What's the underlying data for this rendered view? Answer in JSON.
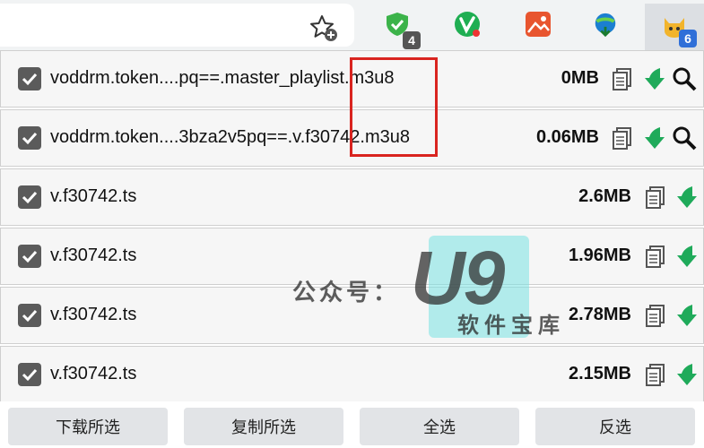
{
  "toolbar": {
    "extensions": [
      {
        "name": "shield-extension",
        "badge": "4",
        "color": "#3cb34a"
      },
      {
        "name": "v-extension",
        "badge": "",
        "color": "#1fae52"
      },
      {
        "name": "image-extension",
        "badge": "",
        "color": "#e8552f"
      },
      {
        "name": "idm-extension",
        "badge": "",
        "color": "#1b7fd1"
      },
      {
        "name": "cat-extension",
        "badge": "6",
        "color": "#f2b42c"
      }
    ]
  },
  "rows": [
    {
      "filename": "voddrm.token....pq==.master_playlist.m3u8",
      "size": "0MB",
      "checked": true,
      "has_search": true
    },
    {
      "filename": "voddrm.token....3bza2v5pq==.v.f30742.m3u8",
      "size": "0.06MB",
      "checked": true,
      "has_search": true
    },
    {
      "filename": "v.f30742.ts",
      "size": "2.6MB",
      "checked": true,
      "has_search": false
    },
    {
      "filename": "v.f30742.ts",
      "size": "1.96MB",
      "checked": true,
      "has_search": false
    },
    {
      "filename": "v.f30742.ts",
      "size": "2.78MB",
      "checked": true,
      "has_search": false
    },
    {
      "filename": "v.f30742.ts",
      "size": "2.15MB",
      "checked": true,
      "has_search": false
    }
  ],
  "watermark": {
    "prefix": "公众号：",
    "logo": "U9",
    "suffix": "软件宝库"
  },
  "buttons": {
    "download_selected": "下载所选",
    "copy_selected": "复制所选",
    "select_all": "全选",
    "invert_selection": "反选"
  },
  "colors": {
    "highlight": "#d9241f",
    "download_arrow": "#1faa5a",
    "checkbox": "#5b5b5b"
  }
}
